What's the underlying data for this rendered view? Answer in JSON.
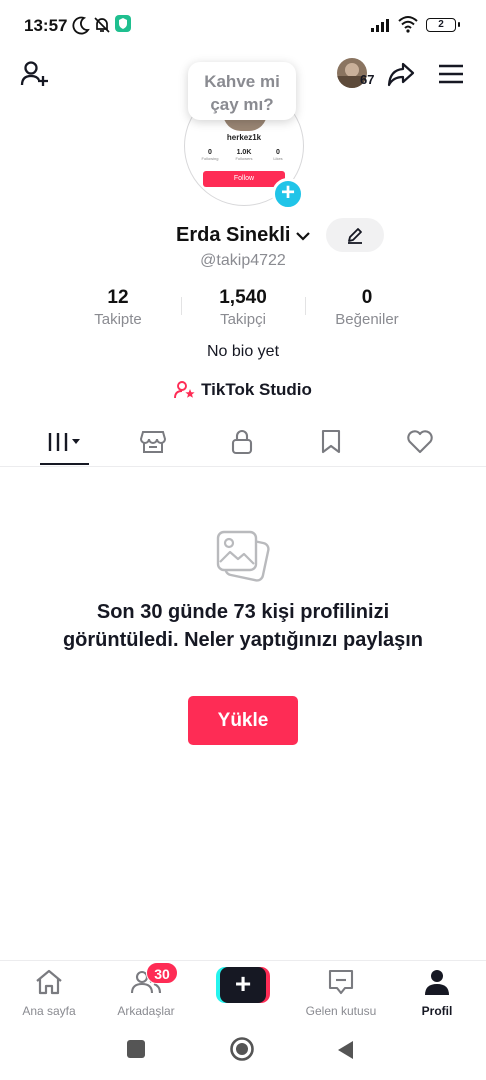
{
  "status_bar": {
    "time": "13:57",
    "battery": "2",
    "icons": [
      "moon-icon",
      "bell-off-icon",
      "shield-app-icon",
      "signal-icon",
      "wifi-icon",
      "battery-icon"
    ]
  },
  "header": {
    "add_friend_icon": "person-plus-icon",
    "notification_count": "67",
    "share_icon": "share-arrow-icon",
    "menu_icon": "hamburger-menu-icon"
  },
  "prompt_bubble": {
    "line1": "Kahve mi",
    "line2": "çay mı?"
  },
  "avatar_preview": {
    "name": "herkez1k",
    "stats": [
      {
        "num": "0",
        "label": "Following"
      },
      {
        "num": "1.0K",
        "label": "Followers"
      },
      {
        "num": "0",
        "label": "Likes"
      }
    ],
    "follow_label": "Follow"
  },
  "profile": {
    "name": "Erda Sinekli",
    "handle": "@takip4722",
    "bio": "No bio yet",
    "studio_label": "TikTok Studio"
  },
  "stats": [
    {
      "value": "12",
      "label": "Takipte"
    },
    {
      "value": "1,540",
      "label": "Takipçi"
    },
    {
      "value": "0",
      "label": "Beğeniler"
    }
  ],
  "tabs": [
    "videos-grid-icon",
    "shop-icon",
    "lock-icon",
    "bookmark-icon",
    "heart-icon"
  ],
  "empty_state": {
    "message": "Son 30 günde 73 kişi profilinizi görüntüledi. Neler yaptığınızı paylaşın",
    "upload_label": "Yükle"
  },
  "bottom_nav": {
    "home": "Ana sayfa",
    "friends": "Arkadaşlar",
    "friends_badge": "30",
    "create": "+",
    "inbox": "Gelen kutusu",
    "profile": "Profil"
  },
  "colors": {
    "accent": "#fe2c55",
    "cyan": "#25f4ee",
    "text": "#161823",
    "muted": "#8a8b91"
  }
}
